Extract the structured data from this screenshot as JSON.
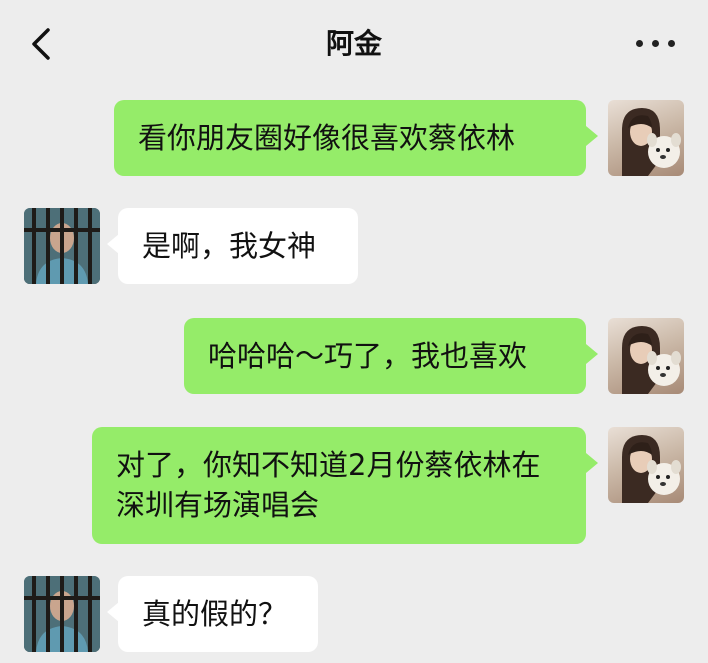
{
  "header": {
    "title": "阿金",
    "back_icon": "chevron-left-icon",
    "more_icon": "more-horizontal-icon"
  },
  "colors": {
    "background": "#ededed",
    "my_bubble": "#95ec69",
    "friend_bubble": "#ffffff"
  },
  "messages": [
    {
      "sender": "me",
      "text": "看你朋友圈好像很喜欢蔡依林"
    },
    {
      "sender": "friend",
      "text": "是啊，我女神"
    },
    {
      "sender": "me",
      "text": "哈哈哈～巧了，我也喜欢"
    },
    {
      "sender": "me",
      "text": "对了，你知不知道2月份蔡依林在深圳有场演唱会"
    },
    {
      "sender": "friend",
      "text": "真的假的？"
    }
  ]
}
